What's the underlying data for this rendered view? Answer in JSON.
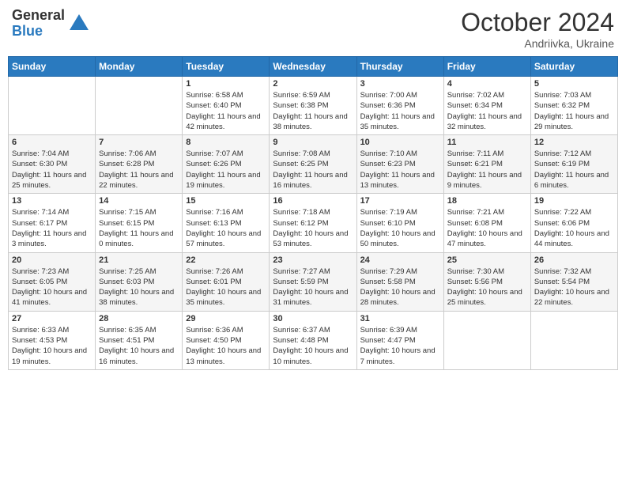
{
  "header": {
    "logo_general": "General",
    "logo_blue": "Blue",
    "title": "October 2024",
    "location": "Andriivka, Ukraine"
  },
  "weekdays": [
    "Sunday",
    "Monday",
    "Tuesday",
    "Wednesday",
    "Thursday",
    "Friday",
    "Saturday"
  ],
  "weeks": [
    [
      {
        "day": "",
        "info": ""
      },
      {
        "day": "",
        "info": ""
      },
      {
        "day": "1",
        "info": "Sunrise: 6:58 AM\nSunset: 6:40 PM\nDaylight: 11 hours\nand 42 minutes."
      },
      {
        "day": "2",
        "info": "Sunrise: 6:59 AM\nSunset: 6:38 PM\nDaylight: 11 hours\nand 38 minutes."
      },
      {
        "day": "3",
        "info": "Sunrise: 7:00 AM\nSunset: 6:36 PM\nDaylight: 11 hours\nand 35 minutes."
      },
      {
        "day": "4",
        "info": "Sunrise: 7:02 AM\nSunset: 6:34 PM\nDaylight: 11 hours\nand 32 minutes."
      },
      {
        "day": "5",
        "info": "Sunrise: 7:03 AM\nSunset: 6:32 PM\nDaylight: 11 hours\nand 29 minutes."
      }
    ],
    [
      {
        "day": "6",
        "info": "Sunrise: 7:04 AM\nSunset: 6:30 PM\nDaylight: 11 hours\nand 25 minutes."
      },
      {
        "day": "7",
        "info": "Sunrise: 7:06 AM\nSunset: 6:28 PM\nDaylight: 11 hours\nand 22 minutes."
      },
      {
        "day": "8",
        "info": "Sunrise: 7:07 AM\nSunset: 6:26 PM\nDaylight: 11 hours\nand 19 minutes."
      },
      {
        "day": "9",
        "info": "Sunrise: 7:08 AM\nSunset: 6:25 PM\nDaylight: 11 hours\nand 16 minutes."
      },
      {
        "day": "10",
        "info": "Sunrise: 7:10 AM\nSunset: 6:23 PM\nDaylight: 11 hours\nand 13 minutes."
      },
      {
        "day": "11",
        "info": "Sunrise: 7:11 AM\nSunset: 6:21 PM\nDaylight: 11 hours\nand 9 minutes."
      },
      {
        "day": "12",
        "info": "Sunrise: 7:12 AM\nSunset: 6:19 PM\nDaylight: 11 hours\nand 6 minutes."
      }
    ],
    [
      {
        "day": "13",
        "info": "Sunrise: 7:14 AM\nSunset: 6:17 PM\nDaylight: 11 hours\nand 3 minutes."
      },
      {
        "day": "14",
        "info": "Sunrise: 7:15 AM\nSunset: 6:15 PM\nDaylight: 11 hours\nand 0 minutes."
      },
      {
        "day": "15",
        "info": "Sunrise: 7:16 AM\nSunset: 6:13 PM\nDaylight: 10 hours\nand 57 minutes."
      },
      {
        "day": "16",
        "info": "Sunrise: 7:18 AM\nSunset: 6:12 PM\nDaylight: 10 hours\nand 53 minutes."
      },
      {
        "day": "17",
        "info": "Sunrise: 7:19 AM\nSunset: 6:10 PM\nDaylight: 10 hours\nand 50 minutes."
      },
      {
        "day": "18",
        "info": "Sunrise: 7:21 AM\nSunset: 6:08 PM\nDaylight: 10 hours\nand 47 minutes."
      },
      {
        "day": "19",
        "info": "Sunrise: 7:22 AM\nSunset: 6:06 PM\nDaylight: 10 hours\nand 44 minutes."
      }
    ],
    [
      {
        "day": "20",
        "info": "Sunrise: 7:23 AM\nSunset: 6:05 PM\nDaylight: 10 hours\nand 41 minutes."
      },
      {
        "day": "21",
        "info": "Sunrise: 7:25 AM\nSunset: 6:03 PM\nDaylight: 10 hours\nand 38 minutes."
      },
      {
        "day": "22",
        "info": "Sunrise: 7:26 AM\nSunset: 6:01 PM\nDaylight: 10 hours\nand 35 minutes."
      },
      {
        "day": "23",
        "info": "Sunrise: 7:27 AM\nSunset: 5:59 PM\nDaylight: 10 hours\nand 31 minutes."
      },
      {
        "day": "24",
        "info": "Sunrise: 7:29 AM\nSunset: 5:58 PM\nDaylight: 10 hours\nand 28 minutes."
      },
      {
        "day": "25",
        "info": "Sunrise: 7:30 AM\nSunset: 5:56 PM\nDaylight: 10 hours\nand 25 minutes."
      },
      {
        "day": "26",
        "info": "Sunrise: 7:32 AM\nSunset: 5:54 PM\nDaylight: 10 hours\nand 22 minutes."
      }
    ],
    [
      {
        "day": "27",
        "info": "Sunrise: 6:33 AM\nSunset: 4:53 PM\nDaylight: 10 hours\nand 19 minutes."
      },
      {
        "day": "28",
        "info": "Sunrise: 6:35 AM\nSunset: 4:51 PM\nDaylight: 10 hours\nand 16 minutes."
      },
      {
        "day": "29",
        "info": "Sunrise: 6:36 AM\nSunset: 4:50 PM\nDaylight: 10 hours\nand 13 minutes."
      },
      {
        "day": "30",
        "info": "Sunrise: 6:37 AM\nSunset: 4:48 PM\nDaylight: 10 hours\nand 10 minutes."
      },
      {
        "day": "31",
        "info": "Sunrise: 6:39 AM\nSunset: 4:47 PM\nDaylight: 10 hours\nand 7 minutes."
      },
      {
        "day": "",
        "info": ""
      },
      {
        "day": "",
        "info": ""
      }
    ]
  ]
}
